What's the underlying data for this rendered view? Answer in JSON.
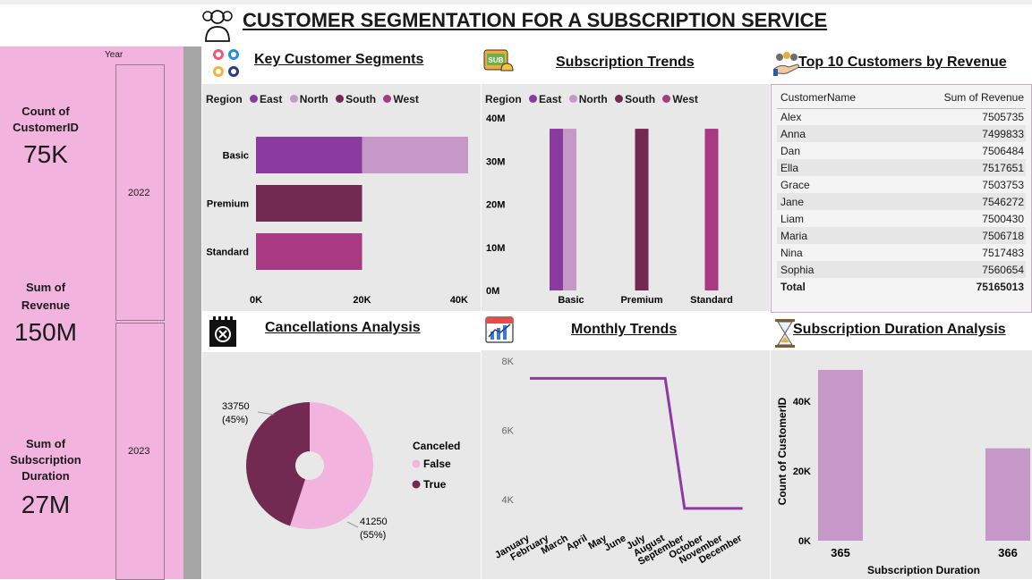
{
  "header": {
    "title": "CUSTOMER SEGMENTATION FOR A SUBSCRIPTION SERVICE"
  },
  "sidebar": {
    "year_label": "Year",
    "years": [
      "2022",
      "2023"
    ],
    "kpis": [
      {
        "label_lines": [
          "Count of",
          "CustomerID"
        ],
        "value": "75K"
      },
      {
        "label_lines": [
          "Sum of",
          "Revenue"
        ],
        "value": "150M"
      },
      {
        "label_lines": [
          "Sum of",
          "Subscription",
          "Duration"
        ],
        "value": "27M"
      }
    ]
  },
  "colors": {
    "East": "#8b3a9f",
    "North": "#c598c8",
    "South": "#722a53",
    "West": "#a83a84",
    "sidebar": "#f2b3de",
    "line": "#8e3a9e",
    "duration_bar": "#c598c8",
    "pie_false": "#f2b3de",
    "pie_true": "#722a53"
  },
  "panels": {
    "segments": {
      "title": "Key Customer Segments"
    },
    "trends": {
      "title": "Subscription Trends"
    },
    "top10": {
      "title": "Top 10 Customers by Revenue"
    },
    "cancellations": {
      "title": "Cancellations Analysis"
    },
    "monthly": {
      "title": "Monthly Trends"
    },
    "duration": {
      "title": "Subscription Duration Analysis"
    }
  },
  "region_legend": {
    "title": "Region",
    "items": [
      "East",
      "North",
      "South",
      "West"
    ]
  },
  "top10_table": {
    "headers": [
      "CustomerName",
      "Sum of Revenue"
    ],
    "rows": [
      [
        "Alex",
        "7505735"
      ],
      [
        "Anna",
        "7499833"
      ],
      [
        "Dan",
        "7506484"
      ],
      [
        "Ella",
        "7517651"
      ],
      [
        "Grace",
        "7503753"
      ],
      [
        "Jane",
        "7546272"
      ],
      [
        "Liam",
        "7500430"
      ],
      [
        "Maria",
        "7506718"
      ],
      [
        "Nina",
        "7517483"
      ],
      [
        "Sophia",
        "7560654"
      ]
    ],
    "total": [
      "Total",
      "75165013"
    ]
  },
  "chart_data": [
    {
      "id": "segments",
      "type": "bar",
      "orientation": "horizontal",
      "stacked": true,
      "title": "Key Customer Segments",
      "categories": [
        "Basic",
        "Premium",
        "Standard"
      ],
      "series": [
        {
          "name": "East",
          "values": [
            20000,
            0,
            0
          ]
        },
        {
          "name": "North",
          "values": [
            20000,
            0,
            0
          ]
        },
        {
          "name": "South",
          "values": [
            0,
            20000,
            0
          ]
        },
        {
          "name": "West",
          "values": [
            0,
            0,
            20000
          ]
        }
      ],
      "xlim": [
        0,
        40000
      ],
      "x_ticks": [
        "0K",
        "20K",
        "40K"
      ],
      "legend": "top-left"
    },
    {
      "id": "trends",
      "type": "bar",
      "title": "Subscription Trends",
      "categories": [
        "Basic",
        "Premium",
        "Standard"
      ],
      "series": [
        {
          "name": "East",
          "values": [
            37500000,
            0,
            0
          ]
        },
        {
          "name": "North",
          "values": [
            37500000,
            0,
            0
          ]
        },
        {
          "name": "South",
          "values": [
            0,
            37500000,
            0
          ]
        },
        {
          "name": "West",
          "values": [
            0,
            0,
            37500000
          ]
        }
      ],
      "ylim": [
        0,
        40000000
      ],
      "y_ticks": [
        "0M",
        "10M",
        "20M",
        "30M",
        "40M"
      ],
      "legend": "top-left"
    },
    {
      "id": "cancellations",
      "type": "pie",
      "donut": true,
      "title": "Cancellations Analysis",
      "legend_title": "Canceled",
      "slices": [
        {
          "name": "False",
          "value": 41250,
          "label": "41250",
          "pct": "(55%)"
        },
        {
          "name": "True",
          "value": 33750,
          "label": "33750",
          "pct": "(45%)"
        }
      ],
      "legend": "right"
    },
    {
      "id": "monthly",
      "type": "line",
      "title": "Monthly Trends",
      "x": [
        "January",
        "February",
        "March",
        "April",
        "May",
        "June",
        "July",
        "August",
        "September",
        "October",
        "November",
        "December"
      ],
      "series": [
        {
          "values": [
            7500,
            7500,
            7500,
            7500,
            7500,
            7500,
            7500,
            7500,
            3750,
            3750,
            3750,
            3750
          ]
        }
      ],
      "ylim": [
        3000,
        8000
      ],
      "y_ticks": [
        {
          "v": 4000,
          "label": "4K"
        },
        {
          "v": 6000,
          "label": "6K"
        },
        {
          "v": 8000,
          "label": "8K"
        }
      ]
    },
    {
      "id": "duration",
      "type": "bar",
      "title": "Subscription Duration Analysis",
      "xlabel": "Subscription Duration",
      "ylabel": "Count of CustomerID",
      "categories": [
        "365",
        "366"
      ],
      "values": [
        49000,
        26500
      ],
      "ylim": [
        0,
        50000
      ],
      "y_ticks": [
        {
          "v": 0,
          "label": "0K"
        },
        {
          "v": 20000,
          "label": "20K"
        },
        {
          "v": 40000,
          "label": "40K"
        }
      ]
    }
  ]
}
